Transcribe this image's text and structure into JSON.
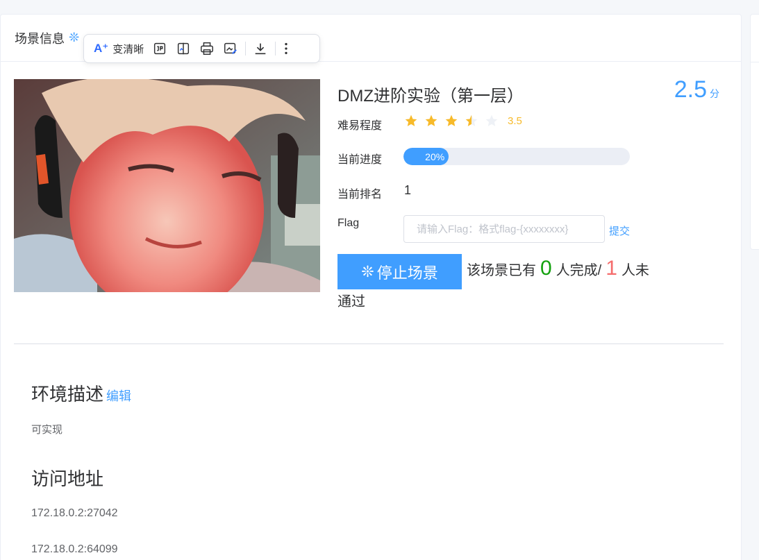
{
  "header": {
    "title": "场景信息"
  },
  "toolbar": {
    "ai_label": "变清晰"
  },
  "scene": {
    "title": "DMZ进阶实验（第一层）",
    "score": "2.5",
    "score_unit": "分",
    "difficulty_label": "难易程度",
    "rating": "3.5",
    "rating_value": 3.5,
    "progress_label": "当前进度",
    "progress_text": "20%",
    "progress_value": 0.2,
    "rank_label": "当前排名",
    "rank": "1",
    "flag_label": "Flag",
    "flag_placeholder": "请输入Flag：格式flag-{xxxxxxxx}",
    "submit_label": "提交",
    "stop_button": "停止场景",
    "stats": {
      "prefix": "该场景已有",
      "completed": "0",
      "completed_suffix": "人完成/",
      "not_passed": "1",
      "not_passed_suffix": "人未",
      "line2": "通过"
    }
  },
  "environment": {
    "title": "环境描述",
    "edit_label": "编辑",
    "description": "可实现"
  },
  "access": {
    "title": "访问地址",
    "addresses": [
      "172.18.0.2:27042",
      "172.18.0.2:64099"
    ]
  },
  "colors": {
    "primary": "#409eff",
    "star": "#f7ba2a",
    "success": "#13a10e",
    "danger": "#f56c6c"
  }
}
